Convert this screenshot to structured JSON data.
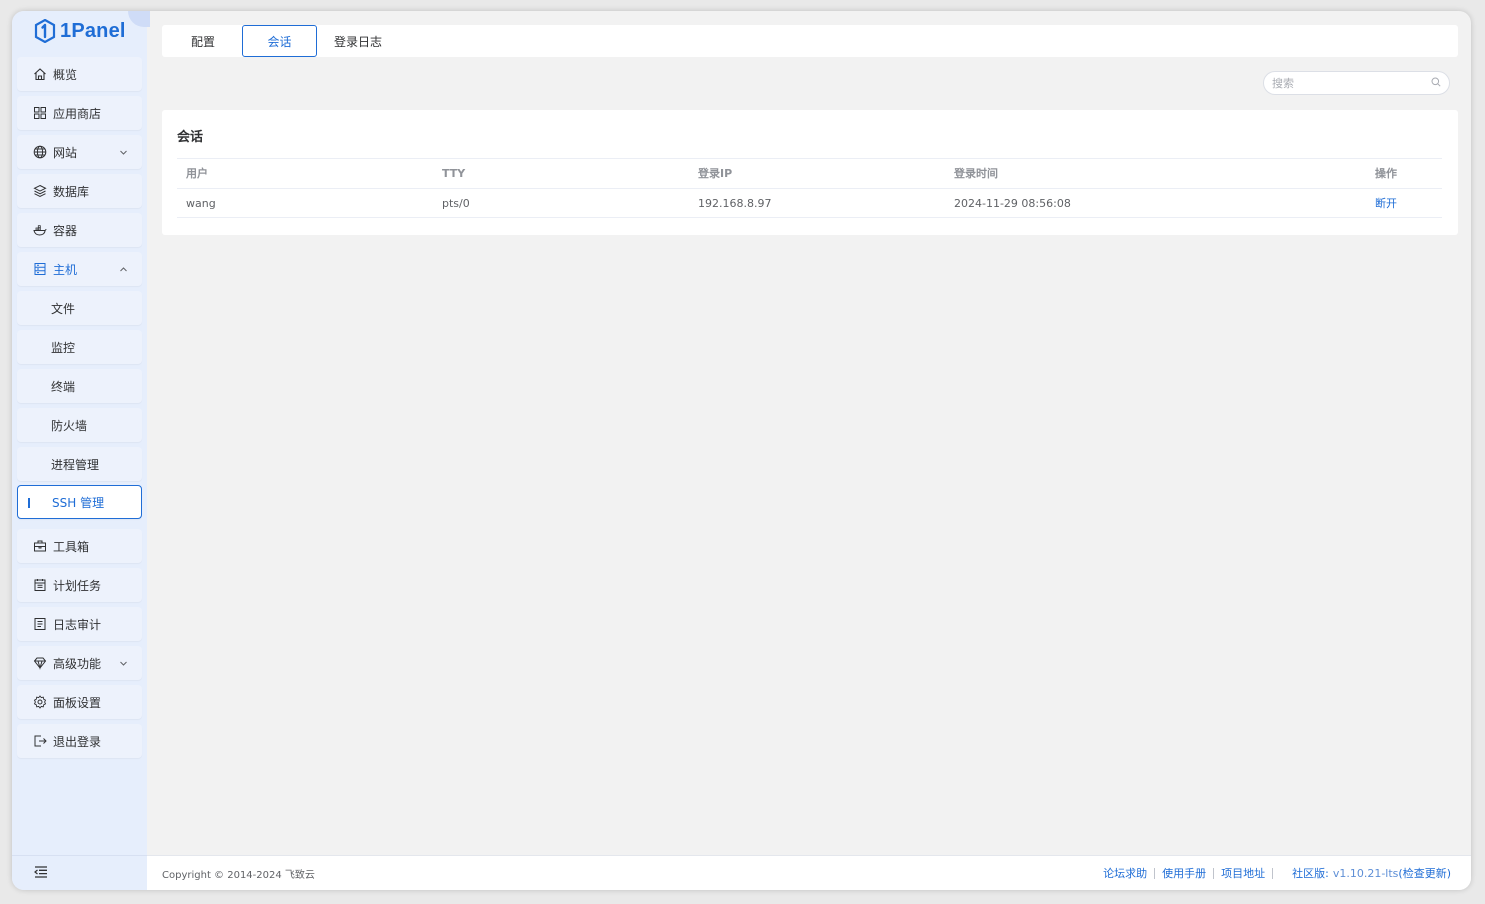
{
  "app": {
    "logo_text": "1Panel"
  },
  "sidebar": {
    "items": [
      {
        "label": "概览",
        "icon": "home-icon"
      },
      {
        "label": "应用商店",
        "icon": "grid-icon"
      },
      {
        "label": "网站",
        "icon": "globe-icon",
        "expandable": true
      },
      {
        "label": "数据库",
        "icon": "layers-icon"
      },
      {
        "label": "容器",
        "icon": "docker-icon"
      },
      {
        "label": "主机",
        "icon": "server-icon",
        "expanded": true
      },
      {
        "label": "文件"
      },
      {
        "label": "监控"
      },
      {
        "label": "终端"
      },
      {
        "label": "防火墙"
      },
      {
        "label": "进程管理"
      },
      {
        "label": "SSH 管理",
        "active": true
      },
      {
        "label": "工具箱",
        "icon": "toolbox-icon"
      },
      {
        "label": "计划任务",
        "icon": "calendar-icon"
      },
      {
        "label": "日志审计",
        "icon": "log-icon"
      },
      {
        "label": "高级功能",
        "icon": "diamond-icon",
        "expandable": true
      },
      {
        "label": "面板设置",
        "icon": "gear-icon"
      },
      {
        "label": "退出登录",
        "icon": "logout-icon"
      }
    ],
    "collapse_icon": "menu-fold-icon"
  },
  "tabs": [
    {
      "label": "配置"
    },
    {
      "label": "会话",
      "active": true
    },
    {
      "label": "登录日志"
    }
  ],
  "search": {
    "placeholder": "搜索",
    "value": ""
  },
  "session_card": {
    "title": "会话",
    "columns": [
      "用户",
      "TTY",
      "登录IP",
      "登录时间",
      "操作"
    ],
    "rows": [
      {
        "user": "wang",
        "tty": "pts/0",
        "ip": "192.168.8.97",
        "time": "2024-11-29 08:56:08",
        "action": "断开"
      }
    ]
  },
  "footer": {
    "copyright": "Copyright © 2014-2024 飞致云",
    "links": [
      "论坛求助",
      "使用手册",
      "项目地址"
    ],
    "edition": "社区版:",
    "version": "v1.10.21-lts",
    "check_update": "(检查更新)"
  },
  "colors": {
    "accent": "#1f6dd6",
    "sidebar_bg": "#e6eefc",
    "content_bg": "#f2f2f2"
  }
}
